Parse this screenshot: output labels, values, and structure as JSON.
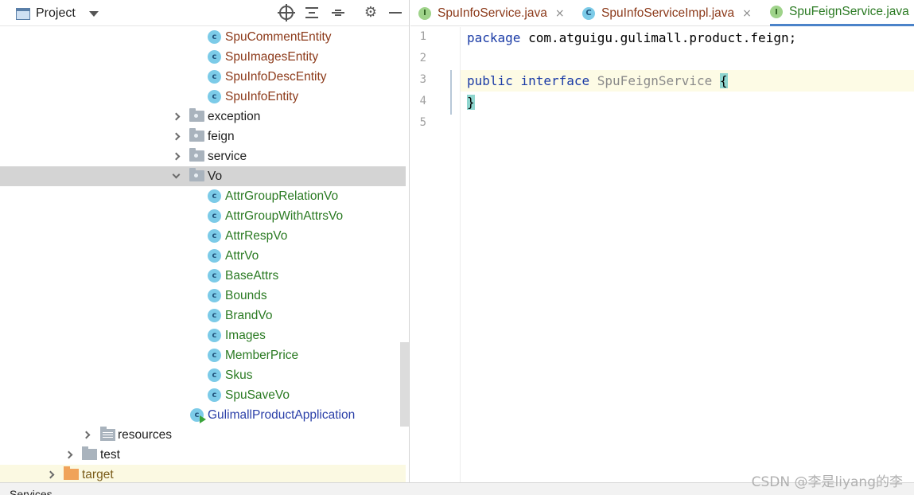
{
  "project_panel": {
    "title": "Project",
    "tools": [
      "locate-icon",
      "expand-all-icon",
      "collapse-all-icon",
      "gear-icon",
      "hide-icon"
    ],
    "tree": [
      {
        "label": "SpuCommentEntity",
        "kind": "class",
        "color": "brown"
      },
      {
        "label": "SpuImagesEntity",
        "kind": "class",
        "color": "brown"
      },
      {
        "label": "SpuInfoDescEntity",
        "kind": "class",
        "color": "brown"
      },
      {
        "label": "SpuInfoEntity",
        "kind": "class",
        "color": "brown"
      },
      {
        "label": "exception",
        "kind": "package",
        "expanded": false
      },
      {
        "label": "feign",
        "kind": "package",
        "expanded": false
      },
      {
        "label": "service",
        "kind": "package",
        "expanded": false
      },
      {
        "label": "Vo",
        "kind": "package",
        "expanded": true,
        "selected": true
      },
      {
        "label": "AttrGroupRelationVo",
        "kind": "class",
        "color": "green"
      },
      {
        "label": "AttrGroupWithAttrsVo",
        "kind": "class",
        "color": "green"
      },
      {
        "label": "AttrRespVo",
        "kind": "class",
        "color": "green"
      },
      {
        "label": "AttrVo",
        "kind": "class",
        "color": "green"
      },
      {
        "label": "BaseAttrs",
        "kind": "class",
        "color": "green"
      },
      {
        "label": "Bounds",
        "kind": "class",
        "color": "green"
      },
      {
        "label": "BrandVo",
        "kind": "class",
        "color": "green"
      },
      {
        "label": "Images",
        "kind": "class",
        "color": "green"
      },
      {
        "label": "MemberPrice",
        "kind": "class",
        "color": "green"
      },
      {
        "label": "Skus",
        "kind": "class",
        "color": "green"
      },
      {
        "label": "SpuSaveVo",
        "kind": "class",
        "color": "green"
      },
      {
        "label": "GulimallProductApplication",
        "kind": "app",
        "color": "blue"
      },
      {
        "label": "resources",
        "kind": "resources",
        "expanded": false
      },
      {
        "label": "test",
        "kind": "folder",
        "expanded": false
      },
      {
        "label": "target",
        "kind": "excluded-folder",
        "expanded": false
      }
    ]
  },
  "editor": {
    "tabs": [
      {
        "label": "SpuInfoService.java",
        "icon": "interface-icon",
        "letter": "I",
        "active": false,
        "close": "×"
      },
      {
        "label": "SpuInfoServiceImpl.java",
        "icon": "class-icon",
        "letter": "C",
        "active": false,
        "close": "×"
      },
      {
        "label": "SpuFeignService.java",
        "icon": "interface-icon",
        "letter": "I",
        "active": true
      }
    ],
    "line_numbers": [
      "1",
      "2",
      "3",
      "4",
      "5"
    ],
    "code": {
      "line1_kw": "package",
      "line1_rest": " com.atguigu.gulimall.product.feign;",
      "line3_kw1": "public",
      "line3_kw2": "interface",
      "line3_name": "SpuFeignService",
      "line3_brace": "{",
      "line4_brace": "}"
    }
  },
  "bottom": {
    "label": "Services"
  },
  "watermark": "CSDN @李是liyang的李",
  "colors": {
    "selected_row": "#d4d4d4",
    "highlight_row": "#fbf9e2",
    "keyword": "#1a3ba6",
    "brace_highlight": "#8fd6cf",
    "active_tab_underline": "#4b83c9"
  }
}
